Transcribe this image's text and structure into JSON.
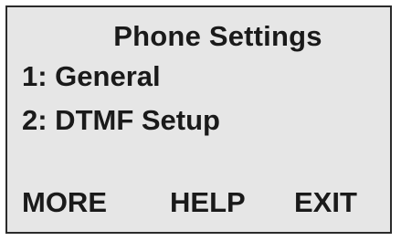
{
  "display": {
    "title": "Phone Settings",
    "menu_items": [
      {
        "label": "1: General"
      },
      {
        "label": "2: DTMF Setup"
      }
    ],
    "softkeys": {
      "more": "MORE",
      "help": "HELP",
      "exit": "EXIT"
    }
  },
  "colors": {
    "screen_background": "#e6e6e6",
    "border": "#2b2b2b",
    "text": "#1a1a1a"
  }
}
